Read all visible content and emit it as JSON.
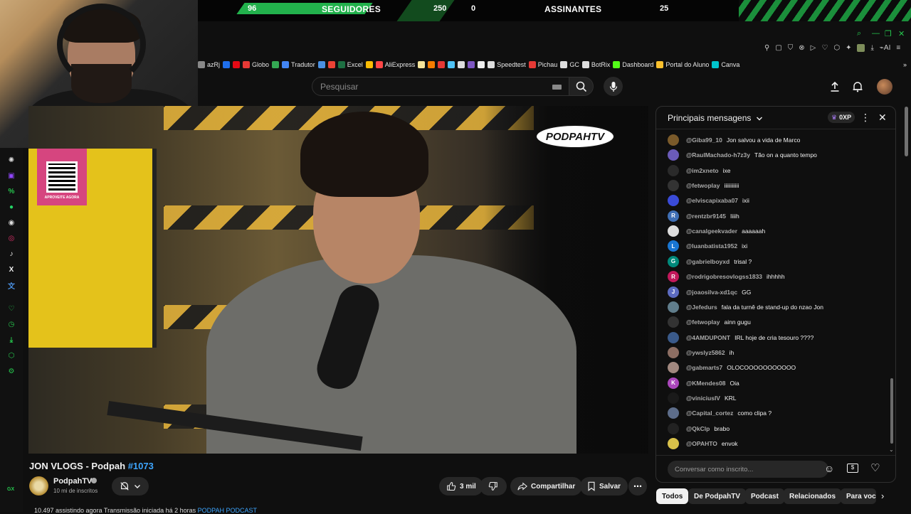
{
  "overlay": {
    "followers_count": "96",
    "followers_label": "SEGUIDORES",
    "followers_goal": "250",
    "subs_count": "0",
    "subs_label": "ASSINANTES",
    "subs_goal": "25"
  },
  "bookmarks": [
    {
      "label": "azRj",
      "icon": "bookmark-icon",
      "color": "#888888"
    },
    {
      "label": "",
      "icon": "play-icon",
      "color": "#1f6feb"
    },
    {
      "label": "",
      "icon": "netflix-icon",
      "color": "#e50914"
    },
    {
      "label": "Globo",
      "icon": "globo-icon",
      "color": "#e53935"
    },
    {
      "label": "",
      "icon": "maps-pin-icon",
      "color": "#34a853"
    },
    {
      "label": "Tradutor",
      "icon": "translate-icon",
      "color": "#4285f4"
    },
    {
      "label": "",
      "icon": "app-icon",
      "color": "#4a90e2"
    },
    {
      "label": "",
      "icon": "gmail-icon",
      "color": "#ea4335"
    },
    {
      "label": "Excel",
      "icon": "excel-icon",
      "color": "#1d6f42"
    },
    {
      "label": "",
      "icon": "drive-icon",
      "color": "#fbbc04"
    },
    {
      "label": "AliExpress",
      "icon": "aliexpress-icon",
      "color": "#ff4747"
    },
    {
      "label": "",
      "icon": "eye-icon",
      "color": "#f5e49b"
    },
    {
      "label": "",
      "icon": "orange-icon",
      "color": "#f57c00"
    },
    {
      "label": "",
      "icon": "bag-icon",
      "color": "#e53935"
    },
    {
      "label": "",
      "icon": "spark-icon",
      "color": "#4fc3f7"
    },
    {
      "label": "",
      "icon": "grid-icon",
      "color": "#dddddd"
    },
    {
      "label": "",
      "icon": "bot-icon",
      "color": "#7e57c2"
    },
    {
      "label": "",
      "icon": "box-icon",
      "color": "#eeeeee"
    },
    {
      "label": "Speedtest",
      "icon": "speedtest-icon",
      "color": "#dddddd"
    },
    {
      "label": "Pichau",
      "icon": "pichau-icon",
      "color": "#e53935"
    },
    {
      "label": "GC",
      "icon": "gc-icon",
      "color": "#dddddd"
    },
    {
      "label": "BotRix",
      "icon": "botrix-icon",
      "color": "#dddddd"
    },
    {
      "label": "Dashboard",
      "icon": "kick-icon",
      "color": "#53fc18"
    },
    {
      "label": "Portal do Aluno",
      "icon": "portal-icon",
      "color": "#fbc02d"
    },
    {
      "label": "Canva",
      "icon": "canva-icon",
      "color": "#00c4cc"
    }
  ],
  "masthead": {
    "search_placeholder": "Pesquisar"
  },
  "brand": "PODPAHTV",
  "qr_text": "APROVEITE AGORA",
  "video": {
    "title": "JON VLOGS - Podpah ",
    "title_tag": "#1073",
    "channel_name": "PodpahTV",
    "subscribers": "10 mi de inscritos",
    "likes": "3 mil",
    "share_label": "Compartilhar",
    "save_label": "Salvar",
    "description_peek": "10.497 assistindo agora  Transmissão iniciada há 2 horas ",
    "description_link": "PODPAH PODCAST"
  },
  "chat": {
    "title": "Principais mensagens",
    "xp": "0XP",
    "input_placeholder": "Conversar como inscrito...",
    "messages": [
      {
        "author": "@Giba99_10",
        "text": "Jon salvou a vida de Marco",
        "avatar_color": "#7a5a2a",
        "initial": ""
      },
      {
        "author": "@RaulMachado-h7z3y",
        "text": "Tão on a quanto tempo",
        "avatar_color": "#6b5bb8",
        "initial": ""
      },
      {
        "author": "@im2xneto",
        "text": "ixe",
        "avatar_color": "#2a2a2a",
        "initial": ""
      },
      {
        "author": "@fetwoplay",
        "text": "iiiiiiiiiii",
        "avatar_color": "#333333",
        "initial": ""
      },
      {
        "author": "@elviscapixaba07",
        "text": "ixii",
        "avatar_color": "#3a4bd8",
        "initial": ""
      },
      {
        "author": "@rentzbr9145",
        "text": "Iiiih",
        "avatar_color": "#3f6fb5",
        "initial": "R"
      },
      {
        "author": "@canalgeekvader",
        "text": "aaaaaah",
        "avatar_color": "#dddddd",
        "initial": ""
      },
      {
        "author": "@luanbatista1952",
        "text": "ixi",
        "avatar_color": "#1976d2",
        "initial": "L"
      },
      {
        "author": "@gabrielboyxd",
        "text": "trisal ?",
        "avatar_color": "#00897b",
        "initial": "G"
      },
      {
        "author": "@rodrigobresovlogss1833",
        "text": "ihhhhh",
        "avatar_color": "#c2185b",
        "initial": "R"
      },
      {
        "author": "@joaosilva-xd1qc",
        "text": "GG",
        "avatar_color": "#5c6bc0",
        "initial": "J"
      },
      {
        "author": "@Jefedurs",
        "text": "fala da turnê de stand-up do nzao Jon",
        "avatar_color": "#607d8b",
        "initial": ""
      },
      {
        "author": "@fetwoplay",
        "text": "ainn gugu",
        "avatar_color": "#333333",
        "initial": ""
      },
      {
        "author": "@4AMDUPONT",
        "text": "IRL hoje de cria tesouro ????",
        "avatar_color": "#3a5a8a",
        "initial": ""
      },
      {
        "author": "@ywslyz5862",
        "text": "ih",
        "avatar_color": "#8d6e63",
        "initial": ""
      },
      {
        "author": "@gabmarts7",
        "text": "OLOCOOOOOOOOOOO",
        "avatar_color": "#a1887f",
        "initial": ""
      },
      {
        "author": "@KMendes08",
        "text": "Oia",
        "avatar_color": "#ab47bc",
        "initial": "K"
      },
      {
        "author": "@viniciusIV",
        "text": "KRL",
        "avatar_color": "#1a1a1a",
        "initial": ""
      },
      {
        "author": "@Capital_cortez",
        "text": "como clipa ?",
        "avatar_color": "#5d6d8a",
        "initial": ""
      },
      {
        "author": "@QkClp",
        "text": "brabo",
        "avatar_color": "#222222",
        "initial": ""
      },
      {
        "author": "@OPAHTO",
        "text": "envok",
        "avatar_color": "#d8c14a",
        "initial": ""
      }
    ]
  },
  "chips": [
    "Todos",
    "De PodpahTV",
    "Podcast",
    "Relacionados",
    "Para você"
  ],
  "left_rail": [
    {
      "icon": "chatgpt-icon",
      "color": "#dddddd",
      "glyph": "✺"
    },
    {
      "icon": "twitch-icon",
      "color": "#9146ff",
      "glyph": "▣"
    },
    {
      "icon": "percent-icon",
      "color": "#26c74e",
      "glyph": "%"
    },
    {
      "icon": "whatsapp-icon",
      "color": "#25d366",
      "glyph": "●"
    },
    {
      "icon": "discord-icon",
      "color": "#dddddd",
      "glyph": "◉"
    },
    {
      "icon": "instagram-icon",
      "color": "#e1306c",
      "glyph": "◎"
    },
    {
      "icon": "tiktok-icon",
      "color": "#eeeeee",
      "glyph": "♪"
    },
    {
      "icon": "x-icon",
      "color": "#eeeeee",
      "glyph": "X"
    },
    {
      "icon": "translate-icon",
      "color": "#4a90e2",
      "glyph": "文"
    },
    {
      "icon": "heart-icon",
      "color": "#26c74e",
      "glyph": "♡"
    },
    {
      "icon": "clock-icon",
      "color": "#26c74e",
      "glyph": "◷"
    },
    {
      "icon": "download-icon",
      "color": "#26c74e",
      "glyph": "⤓"
    },
    {
      "icon": "cube-icon",
      "color": "#26c74e",
      "glyph": "⬡"
    },
    {
      "icon": "settings-icon",
      "color": "#26c74e",
      "glyph": "⚙"
    }
  ],
  "rail_footer": "GX"
}
